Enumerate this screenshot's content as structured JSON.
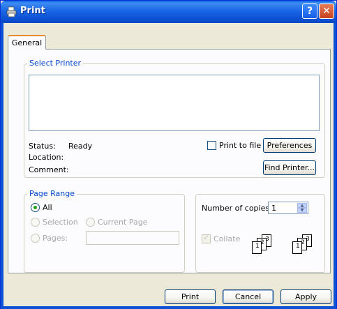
{
  "window": {
    "title": "Print",
    "help_glyph": "?",
    "close_glyph": "✕"
  },
  "tabs": [
    {
      "label": "General"
    }
  ],
  "select_printer": {
    "group_label": "Select Printer",
    "status_label": "Status:",
    "status_value": "Ready",
    "location_label": "Location:",
    "comment_label": "Comment:",
    "print_to_file_label": "Print to file",
    "print_to_file_checked": false,
    "preferences_button": "Preferences",
    "find_printer_button": "Find Printer..."
  },
  "page_range": {
    "group_label": "Page Range",
    "all_label": "All",
    "selection_label": "Selection",
    "current_page_label": "Current Page",
    "pages_label": "Pages:",
    "pages_value": "",
    "selected": "All"
  },
  "copies": {
    "label": "Number of copies:",
    "value": "1",
    "collate_label": "Collate",
    "collate_checked": true,
    "collate_enabled": false
  },
  "buttons": {
    "print": "Print",
    "cancel": "Cancel",
    "apply": "Apply"
  },
  "colors": {
    "title_bar": "#0d52d4",
    "group_label": "#0046d5",
    "dialog_bg": "#ece9d8"
  }
}
